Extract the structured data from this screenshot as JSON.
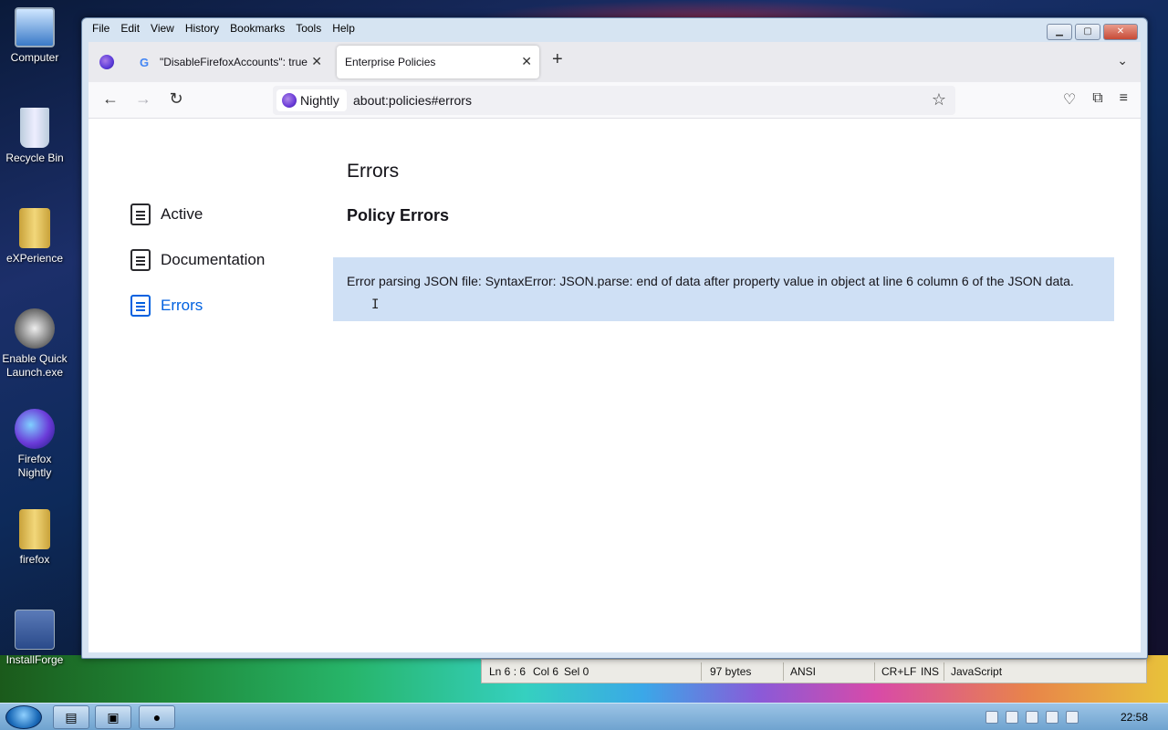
{
  "desktop": {
    "icons": [
      {
        "label": "Computer"
      },
      {
        "label": "Recycle Bin"
      },
      {
        "label": "eXPerience"
      },
      {
        "label": "Enable Quick Launch.exe"
      },
      {
        "label": "Firefox Nightly"
      },
      {
        "label": "firefox"
      },
      {
        "label": "InstallForge"
      }
    ]
  },
  "window": {
    "menus": [
      "File",
      "Edit",
      "View",
      "History",
      "Bookmarks",
      "Tools",
      "Help"
    ]
  },
  "tabs": [
    {
      "title": "\"DisableFirefoxAccounts\": true"
    },
    {
      "title": "Enterprise Policies"
    }
  ],
  "navbar": {
    "identity_label": "Nightly",
    "url": "about:policies#errors"
  },
  "sidebar": {
    "items": [
      {
        "label": "Active"
      },
      {
        "label": "Documentation"
      },
      {
        "label": "Errors"
      }
    ]
  },
  "main": {
    "page_title": "Errors",
    "section_title": "Policy Errors",
    "error_message": "Error parsing JSON file: SyntaxError: JSON.parse: end of data after property value in object at line 6 column 6 of the JSON data."
  },
  "statusbar": {
    "ln": "Ln 6 : 6",
    "col": "Col 6",
    "sel": "Sel 0",
    "size": "97 bytes",
    "encoding": "ANSI",
    "eol": "CR+LF",
    "mode": "INS",
    "language": "JavaScript"
  },
  "taskbar": {
    "clock": "22:58"
  }
}
